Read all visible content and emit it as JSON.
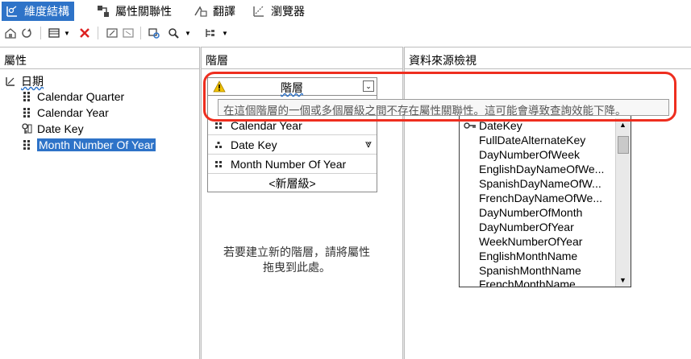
{
  "tabs": [
    {
      "label": "維度結構",
      "active": true,
      "icon": "dimension-structure-icon"
    },
    {
      "label": "屬性關聯性",
      "active": false,
      "icon": "attribute-relationship-icon"
    },
    {
      "label": "翻譯",
      "active": false,
      "icon": "translation-icon"
    },
    {
      "label": "瀏覽器",
      "active": false,
      "icon": "browser-icon"
    }
  ],
  "panes": {
    "attributes_header": "屬性",
    "hierarchies_header": "階層",
    "dsv_header": "資料來源檢視"
  },
  "attributes": {
    "root": "日期",
    "items": [
      {
        "label": "Calendar Quarter",
        "icon": "attribute-icon",
        "selected": false
      },
      {
        "label": "Calendar Year",
        "icon": "attribute-icon",
        "selected": false
      },
      {
        "label": "Date Key",
        "icon": "key-attribute-icon",
        "selected": false
      },
      {
        "label": "Month Number Of Year",
        "icon": "attribute-icon",
        "selected": true
      }
    ]
  },
  "hierarchy": {
    "title": "階層",
    "levels": [
      {
        "label": "Calendar Year"
      },
      {
        "label": "Date Key"
      },
      {
        "label": "Month Number Of Year"
      }
    ],
    "new_level": "<新層級>"
  },
  "hint_line1": "若要建立新的階層，請將屬性",
  "hint_line2": "拖曳到此處。",
  "tooltip": "在這個階層的一個或多個層級之間不存在屬性關聯性。這可能會導致查詢效能下降。",
  "dsv_columns": [
    "DateKey",
    "FullDateAlternateKey",
    "DayNumberOfWeek",
    "EnglishDayNameOfWe...",
    "SpanishDayNameOfW...",
    "FrenchDayNameOfWe...",
    "DayNumberOfMonth",
    "DayNumberOfYear",
    "WeekNumberOfYear",
    "EnglishMonthName",
    "SpanishMonthName",
    "FrenchMonthName"
  ],
  "colors": {
    "accent": "#2e73c8",
    "callout": "#ee2e1f",
    "warning": "#f2c200"
  }
}
